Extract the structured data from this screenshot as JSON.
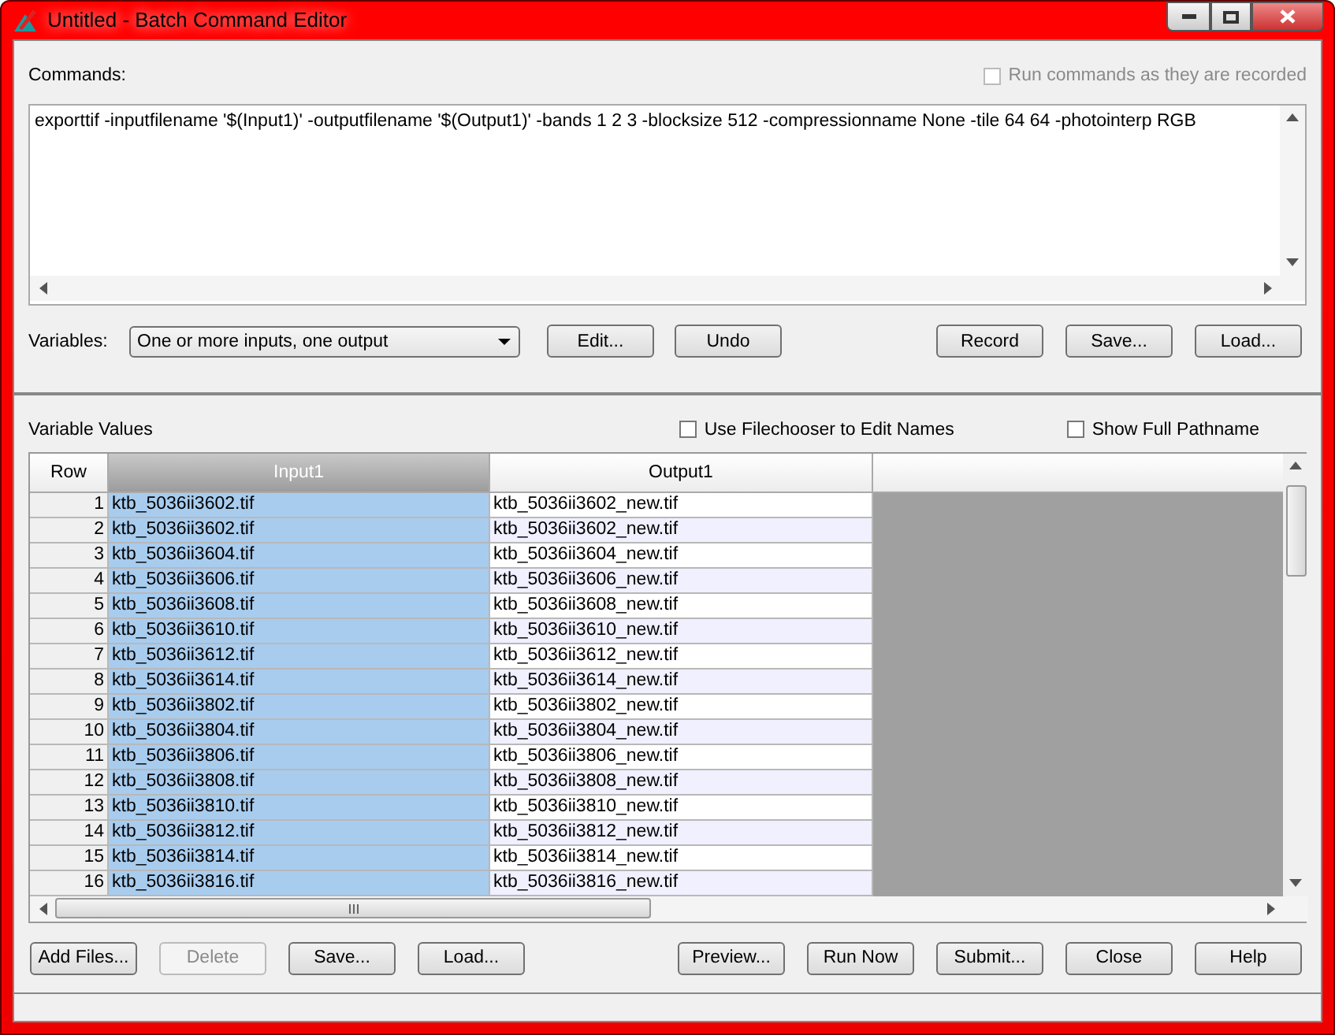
{
  "window": {
    "title": "Untitled - Batch Command Editor"
  },
  "commands": {
    "label": "Commands:",
    "run_as_recorded": {
      "label": "Run commands as they are recorded",
      "checked": false,
      "disabled": true
    },
    "text": "exporttif -inputfilename '$(Input1)' -outputfilename '$(Output1)' -bands 1 2 3 -blocksize 512 -compressionname None -tile 64 64 -photointerp RGB"
  },
  "variables": {
    "label": "Variables:",
    "value": "One or more inputs, one output",
    "left_buttons": [
      "Edit...",
      "Undo"
    ],
    "right_buttons": [
      "Record",
      "Save...",
      "Load..."
    ]
  },
  "variable_values": {
    "label": "Variable Values",
    "options": [
      {
        "label": "Use Filechooser to Edit Names",
        "checked": false
      },
      {
        "label": "Show Full Pathname",
        "checked": false
      }
    ]
  },
  "table": {
    "columns": [
      {
        "label": "Row",
        "selected": false
      },
      {
        "label": "Input1",
        "selected": true
      },
      {
        "label": "Output1",
        "selected": false
      }
    ],
    "rows": [
      [
        "1",
        "ktb_5036ii3602.tif",
        "ktb_5036ii3602_new.tif"
      ],
      [
        "2",
        "ktb_5036ii3602.tif",
        "ktb_5036ii3602_new.tif"
      ],
      [
        "3",
        "ktb_5036ii3604.tif",
        "ktb_5036ii3604_new.tif"
      ],
      [
        "4",
        "ktb_5036ii3606.tif",
        "ktb_5036ii3606_new.tif"
      ],
      [
        "5",
        "ktb_5036ii3608.tif",
        "ktb_5036ii3608_new.tif"
      ],
      [
        "6",
        "ktb_5036ii3610.tif",
        "ktb_5036ii3610_new.tif"
      ],
      [
        "7",
        "ktb_5036ii3612.tif",
        "ktb_5036ii3612_new.tif"
      ],
      [
        "8",
        "ktb_5036ii3614.tif",
        "ktb_5036ii3614_new.tif"
      ],
      [
        "9",
        "ktb_5036ii3802.tif",
        "ktb_5036ii3802_new.tif"
      ],
      [
        "10",
        "ktb_5036ii3804.tif",
        "ktb_5036ii3804_new.tif"
      ],
      [
        "11",
        "ktb_5036ii3806.tif",
        "ktb_5036ii3806_new.tif"
      ],
      [
        "12",
        "ktb_5036ii3808.tif",
        "ktb_5036ii3808_new.tif"
      ],
      [
        "13",
        "ktb_5036ii3810.tif",
        "ktb_5036ii3810_new.tif"
      ],
      [
        "14",
        "ktb_5036ii3812.tif",
        "ktb_5036ii3812_new.tif"
      ],
      [
        "15",
        "ktb_5036ii3814.tif",
        "ktb_5036ii3814_new.tif"
      ],
      [
        "16",
        "ktb_5036ii3816.tif",
        "ktb_5036ii3816_new.tif"
      ]
    ]
  },
  "left_buttons": [
    {
      "label": "Add Files...",
      "disabled": false
    },
    {
      "label": "Delete",
      "disabled": true
    },
    {
      "label": "Save...",
      "disabled": false
    },
    {
      "label": "Load...",
      "disabled": false
    }
  ],
  "right_buttons": [
    {
      "label": "Preview...",
      "disabled": false
    },
    {
      "label": "Run Now",
      "disabled": false
    },
    {
      "label": "Submit...",
      "disabled": false
    },
    {
      "label": "Close",
      "disabled": false
    },
    {
      "label": "Help",
      "disabled": false
    }
  ]
}
